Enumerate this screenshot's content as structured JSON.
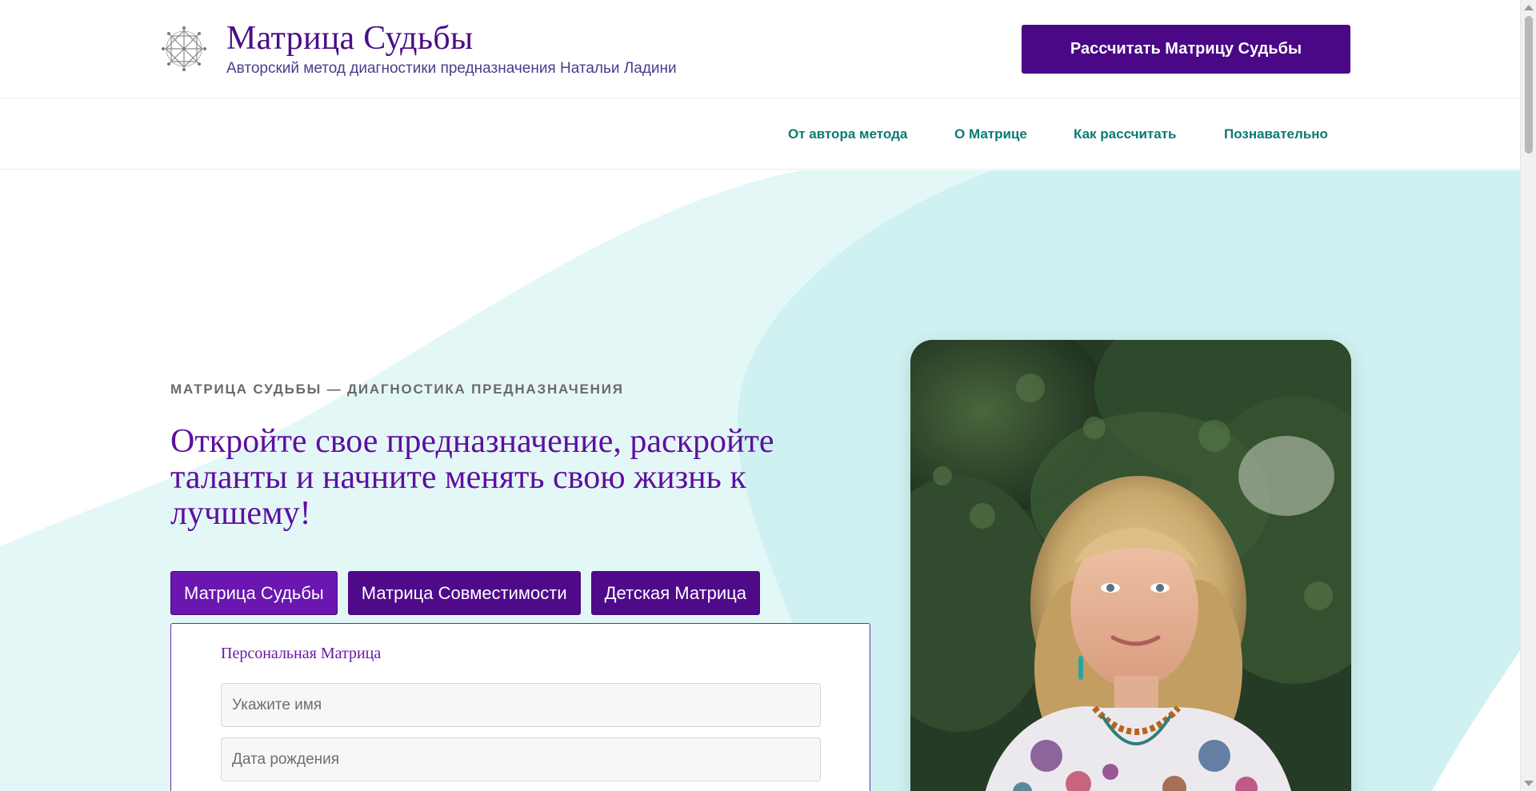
{
  "header": {
    "brand_title": "Матрица Судьбы",
    "brand_subtitle": "Авторский метод диагностики предназначения Натальи Ладини",
    "cta_label": "Рассчитать Матрицу Судьбы",
    "logo_icon": "star-of-lakshmi-icon"
  },
  "nav": {
    "items": [
      {
        "label": "От автора метода"
      },
      {
        "label": "О Матрице"
      },
      {
        "label": "Как рассчитать"
      },
      {
        "label": "Познавательно"
      }
    ]
  },
  "hero": {
    "eyebrow": "МАТРИЦА СУДЬБЫ — ДИАГНОСТИКА ПРЕДНАЗНАЧЕНИЯ",
    "headline": "Откройте свое предназначение, раскройте таланты и начните менять свою жизнь к лучшему!",
    "tabs": [
      {
        "label": "Матрица Судьбы",
        "active": true
      },
      {
        "label": "Матрица Совместимости",
        "active": false
      },
      {
        "label": "Детская Матрица",
        "active": false
      }
    ],
    "form": {
      "title": "Персональная Матрица",
      "name_placeholder": "Укажите имя",
      "name_value": "",
      "birthdate_placeholder": "Дата рождения",
      "birthdate_value": ""
    },
    "photo_description_icon": "author-portrait-photo"
  },
  "colors": {
    "brand_purple": "#4a0786",
    "accent_purple": "#6b16b0",
    "nav_teal": "#0a7a72",
    "bg_mint": "#d0f2f2"
  }
}
